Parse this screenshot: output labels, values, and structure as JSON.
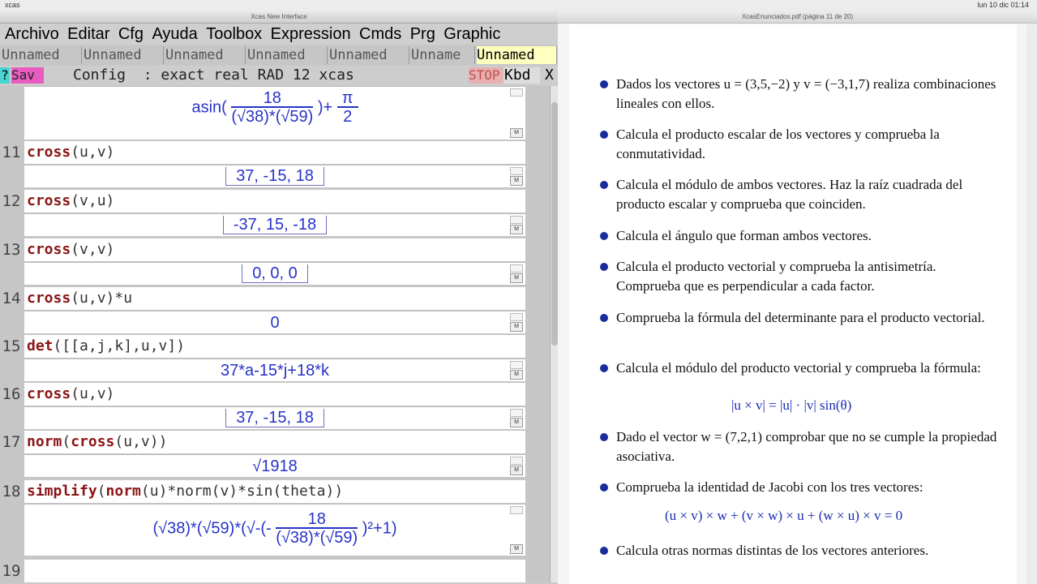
{
  "macbar": {
    "left": "xcas",
    "right": "lun 10 dic 01:14"
  },
  "xcas": {
    "title": "Xcas New Interface",
    "menu": [
      "Archivo",
      "Editar",
      "Cfg",
      "Ayuda",
      "Toolbox",
      "Expression",
      "Cmds",
      "Prg",
      "Graphic"
    ],
    "tabs": [
      "Unnamed",
      "Unnamed",
      "Unnamed",
      "Unnamed",
      "Unnamed",
      "Unname",
      "Unnamed"
    ],
    "toolbar": {
      "help": "?",
      "save": "Sav",
      "config": "Config  : exact real RAD 12 xcas",
      "stop": "STOP",
      "kbd": "Kbd",
      "close": "X"
    },
    "prev_result": {
      "func": "asin(",
      "num": "18",
      "den": "(√38)*(√59)",
      "plus": ")+",
      "pi_num": "π",
      "pi_den": "2"
    },
    "levels": [
      {
        "n": "11",
        "cmd_kw": "cross",
        "cmd_rest": "(u,v)",
        "result": "37,  -15,  18"
      },
      {
        "n": "12",
        "cmd_kw": "cross",
        "cmd_rest": "(v,u)",
        "result": "-37,  15,  -18"
      },
      {
        "n": "13",
        "cmd_kw": "cross",
        "cmd_rest": "(v,v)",
        "result": "0,  0,  0"
      },
      {
        "n": "14",
        "cmd_kw": "cross",
        "cmd_rest": "(u,v)*u",
        "result": "0"
      },
      {
        "n": "15",
        "cmd_kw": "det",
        "cmd_rest": "([[a,j,k],u,v])",
        "result": "37*a-15*j+18*k"
      },
      {
        "n": "16",
        "cmd_kw": "cross",
        "cmd_rest": "(u,v)",
        "result": "37,  -15,  18"
      },
      {
        "n": "17",
        "cmd_kw": "norm",
        "cmd_mid": "(",
        "cmd_kw2": "cross",
        "cmd_rest": "(u,v))",
        "result": "√1918"
      },
      {
        "n": "18",
        "cmd_kw": "simplify",
        "cmd_mid": "(",
        "cmd_kw2": "norm",
        "cmd_rest": "(u)*norm(v)*sin(theta))",
        "result_pre": "(√38)*(√59)*(√-(-",
        "result_num": "18",
        "result_den": "(√38)*(√59)",
        "result_post": ")²+1)"
      },
      {
        "n": "19"
      }
    ]
  },
  "pdf": {
    "title": "XcasEnunciados.pdf (página 11 de 20)",
    "items": [
      "Dados los vectores u = (3,5,−2) y v = (−3,1,7) realiza combinaciones lineales con ellos.",
      "Calcula el producto escalar de los vectores y comprueba la conmutatividad.",
      "Calcula el módulo de ambos vectores. Haz la raíz cuadrada del producto escalar y comprueba que coinciden.",
      "Calcula el ángulo que forman ambos vectores.",
      "Calcula el producto vectorial y comprueba la antisimetría. Comprueba que es perpendicular a cada factor.",
      "Comprueba la fórmula del determinante para el producto vectorial.",
      "Calcula el módulo del producto vectorial y comprueba la fórmula:",
      "Dado el vector w = (7,2,1) comprobar que no se cumple la propiedad asociativa.",
      "Comprueba la identidad de Jacobi con los tres vectores:",
      "Calcula otras normas distintas de los vectores anteriores."
    ],
    "formula1": "|u × v| = |u| · |v| sin(θ)",
    "formula2": "(u × v) × w + (v × w) × u + (w × u) × v = 0"
  }
}
